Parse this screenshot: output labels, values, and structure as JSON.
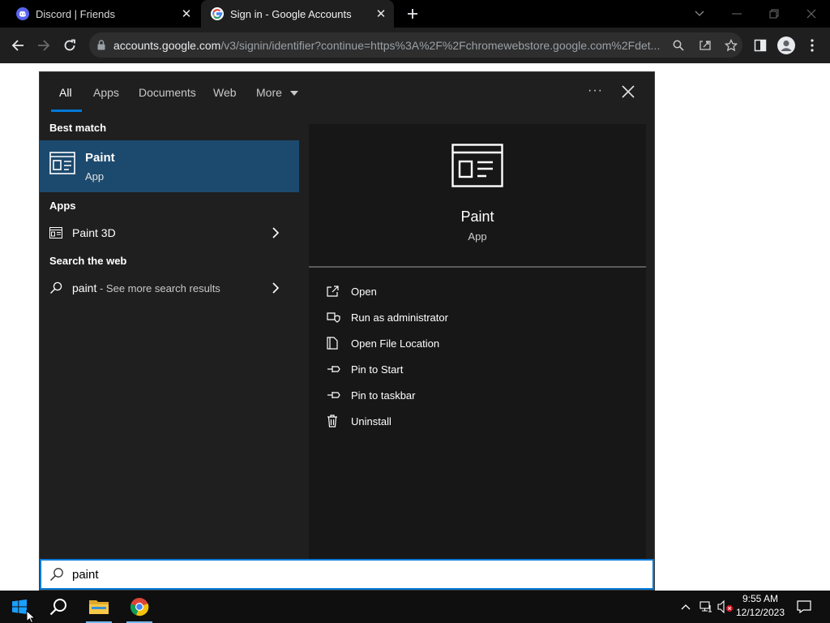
{
  "browser": {
    "tabs": [
      {
        "title": "Discord | Friends",
        "active": false,
        "favicon": "discord-icon"
      },
      {
        "title": "Sign in - Google Accounts",
        "active": true,
        "favicon": "google-icon"
      }
    ],
    "url_host": "accounts.google.com",
    "url_path": "/v3/signin/identifier?continue=https%3A%2F%2Fchromewebstore.google.com%2Fdet..."
  },
  "search": {
    "tabs": [
      "All",
      "Apps",
      "Documents",
      "Web",
      "More"
    ],
    "best_match_label": "Best match",
    "best_match": {
      "name": "Paint",
      "type": "App"
    },
    "apps_label": "Apps",
    "apps": [
      {
        "name": "Paint 3D"
      }
    ],
    "web_label": "Search the web",
    "web_result": {
      "query": "paint",
      "suffix": " - See more search results"
    },
    "detail": {
      "name": "Paint",
      "type": "App"
    },
    "actions": [
      "Open",
      "Run as administrator",
      "Open File Location",
      "Pin to Start",
      "Pin to taskbar",
      "Uninstall"
    ],
    "query": "paint"
  },
  "taskbar": {
    "time": "9:55 AM",
    "date": "12/12/2023"
  },
  "colors": {
    "accent": "#0078d7",
    "selection": "#1c4a6e"
  }
}
